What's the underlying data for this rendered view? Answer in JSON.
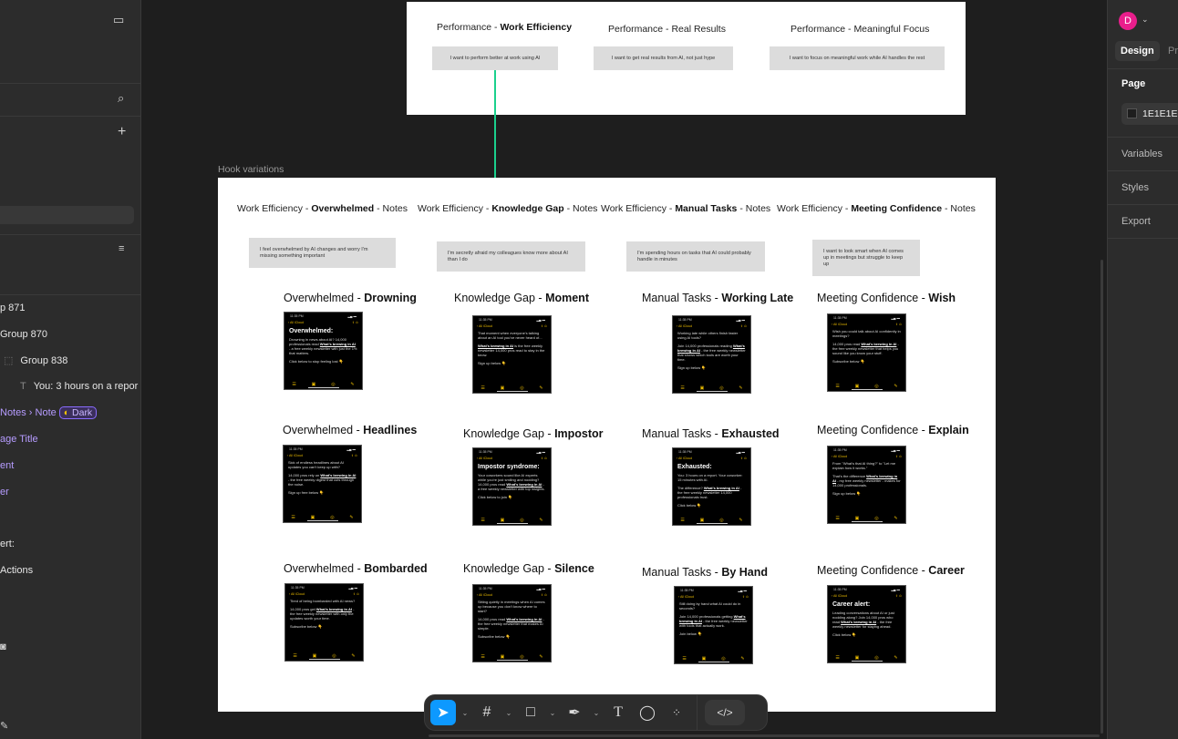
{
  "left_panel": {
    "layers": [
      {
        "label": "p 871"
      },
      {
        "label": "Group 870"
      },
      {
        "label": "Group 838"
      },
      {
        "label": "You: 3 hours on a repor"
      },
      {
        "label": "Notes › Note",
        "badge": "Dark"
      },
      {
        "label": "age Title"
      },
      {
        "label": "ent"
      },
      {
        "label": "er"
      },
      {
        "label": "ert:"
      },
      {
        "label": "Actions"
      }
    ]
  },
  "right_panel": {
    "avatar": "D",
    "avatar_color": "#e91e8c",
    "tabs": [
      "Design",
      "Pr"
    ],
    "page_label": "Page",
    "page_color": "1E1E1E",
    "sections": [
      "Variables",
      "Styles",
      "Export"
    ]
  },
  "top_frame": {
    "columns": [
      {
        "prefix": "Performance - ",
        "bold": "Work Efficiency",
        "note": "I want to perform better at work using AI"
      },
      {
        "prefix": "Performance - Real Results",
        "bold": "",
        "note": "I want to get real results from AI, not just hype"
      },
      {
        "prefix": "Performance - Meaningful Focus",
        "bold": "",
        "note": "I want to focus on meaningful work while AI handles the rest"
      }
    ]
  },
  "hook_frame": {
    "label": "Hook variations",
    "columns": [
      {
        "prefix": "Work Efficiency - ",
        "bold": "Overwhelmed",
        "suffix": " - Notes",
        "note": "I feel overwhelmed by AI changes and worry I'm missing something important"
      },
      {
        "prefix": "Work Efficiency - ",
        "bold": "Knowledge Gap",
        "suffix": " - Notes",
        "note": "I'm secretly afraid my colleagues know more about AI than I do"
      },
      {
        "prefix": "Work Efficiency - ",
        "bold": "Manual Tasks",
        "suffix": " - Notes",
        "note": "I'm spending hours on tasks that AI could probably handle in minutes"
      },
      {
        "prefix": "Work Efficiency - ",
        "bold": "Meeting Confidence",
        "suffix": " - Notes",
        "note": "I want to look smart when AI comes up in meetings but struggle to keep up"
      }
    ],
    "phone_common": {
      "time": "11:35 PM",
      "back": "All iCloud",
      "link": "What's brewing in AI"
    },
    "hooks": [
      {
        "prefix": "Overwhelmed - ",
        "bold": "Drowning",
        "heading": "Overwhelmed:",
        "paras": [
          "Drowning in news about AI? 14,000 professionals read What's brewing in AI - a free weekly newsletter with just the 1% that matters.",
          "Click below to stop feeling lost 👇"
        ]
      },
      {
        "prefix": "Knowledge Gap - ",
        "bold": "Moment",
        "heading": "",
        "paras": [
          "That moment when everyone's talking about an AI tool you've never heard of...",
          "What's brewing in AI is the free weekly newsletter 14,000 pros read to stay in the know.",
          "Sign up below 👇"
        ]
      },
      {
        "prefix": "Manual Tasks - ",
        "bold": "Working Late",
        "heading": "",
        "paras": [
          "Working late while others finish faster using AI tools?",
          "Join 14,000 professionals reading What's brewing in AI - the free weekly newsletter that shows which tools are worth your time.",
          "Sign up below 👇"
        ]
      },
      {
        "prefix": "Meeting Confidence - ",
        "bold": "Wish",
        "heading": "",
        "paras": [
          "Wish you could talk about AI confidently in meetings?",
          "14,000 pros read What's brewing in AI - the free weekly newsletter that helps you sound like you know your stuff.",
          "Subscribe below 👇"
        ]
      },
      {
        "prefix": "Overwhelmed - ",
        "bold": "Headlines",
        "heading": "",
        "paras": [
          "Sick of endless headlines about AI updates you can't keep up with?",
          "14,000 pros rely on What's brewing in AI - the free weekly digest that cuts through the noise.",
          "Sign up free below 👇"
        ]
      },
      {
        "prefix": "Knowledge Gap - ",
        "bold": "Impostor",
        "heading": "Impostor syndrome:",
        "paras": [
          "Your coworkers sound like AI experts while you're just smiling and nodding? 14,000 pros read What's brewing in AI - a free weekly newsletter with top insights.",
          "Click below to join 👇"
        ]
      },
      {
        "prefix": "Manual Tasks - ",
        "bold": "Exhausted",
        "heading": "Exhausted:",
        "paras": [
          "You: 3 hours on a report. Your coworker: 15 minutes with AI.",
          "The difference? What's brewing in AI - the free weekly newsletter 14,000 professionals trust.",
          "Click below 👇"
        ]
      },
      {
        "prefix": "Meeting Confidence - ",
        "bold": "Explain",
        "heading": "",
        "paras": [
          "From \"What's that AI thing?\" to \"Let me explain how it works.\"",
          "That's the difference What's brewing in AI - my free weekly newsletter - makes for 14,000 professionals.",
          "Sign up below 👇"
        ]
      },
      {
        "prefix": "Overwhelmed - ",
        "bold": "Bombarded",
        "heading": "",
        "paras": [
          "Tired of being bombarded with AI news?",
          "14,000 pros get What's brewing in AI - the free weekly newsletter with only the updates worth your time.",
          "Subscribe below 👇"
        ]
      },
      {
        "prefix": "Knowledge Gap - ",
        "bold": "Silence",
        "heading": "",
        "paras": [
          "Sitting quietly in meetings when AI comes up because you don't know where to start?",
          "14,000 pros read What's brewing in AI - the free weekly newsletter that makes AI simple.",
          "Subscribe below 👇"
        ]
      },
      {
        "prefix": "Manual Tasks - ",
        "bold": "By Hand",
        "heading": "",
        "paras": [
          "Still doing by hand what AI could do in seconds?",
          "Join 14,000 professionals getting What's brewing in AI - the free weekly newsletter with tools that actually work.",
          "Join below 👇"
        ]
      },
      {
        "prefix": "Meeting Confidence - ",
        "bold": "Career",
        "heading": "Career alert:",
        "paras": [
          "Leading conversations about AI or just nodding along? Join 14,000 pros who read What's brewing in AI - the free weekly newsletter for staying ahead.",
          "Click below 👇"
        ]
      }
    ]
  },
  "colors": {
    "canvas": "#1e1e1e",
    "panel": "#2c2c2c",
    "accent": "#0d99ff",
    "connector": "#1bd08d"
  }
}
